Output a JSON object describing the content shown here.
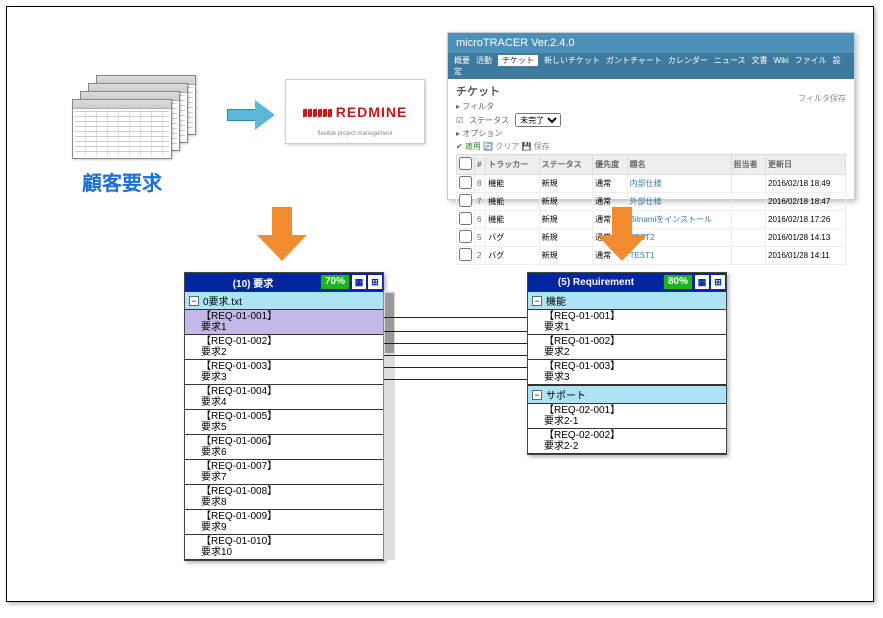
{
  "customer_label": "顧客要求",
  "redmine": {
    "name": "REDMINE",
    "sub": "flexible project management"
  },
  "rm_window": {
    "title": "microTRACER Ver.2.4.0",
    "menu": [
      "概要",
      "活動",
      "チケット",
      "新しいチケット",
      "ガントチャート",
      "カレンダー",
      "ニュース",
      "文書",
      "Wiki",
      "ファイル",
      "設定"
    ],
    "active_tab": "チケット",
    "heading": "チケット",
    "filter_label": "フィルタ",
    "status_label": "ステータス",
    "status_value": "未完了",
    "options_label": "オプション",
    "side_label": "フィルタ保存",
    "actions": {
      "apply": "✔ 適用",
      "clear": "🔄 クリア",
      "save": "💾 保存"
    },
    "cols": [
      "#",
      "トラッカー",
      "ステータス",
      "優先度",
      "題名",
      "担当者",
      "更新日"
    ],
    "rows": [
      {
        "id": "8",
        "tracker": "機能",
        "status": "新規",
        "prio": "通常",
        "title": "内部仕様",
        "assignee": "",
        "date": "2016/02/18 18:49"
      },
      {
        "id": "7",
        "tracker": "機能",
        "status": "新規",
        "prio": "通常",
        "title": "外部仕様",
        "assignee": "",
        "date": "2016/02/18 18:47"
      },
      {
        "id": "6",
        "tracker": "機能",
        "status": "新規",
        "prio": "通常",
        "title": "Bitnamiをインストール",
        "assignee": "",
        "date": "2016/02/18 17:26"
      },
      {
        "id": "5",
        "tracker": "バグ",
        "status": "新規",
        "prio": "通常",
        "title": "TEST2",
        "assignee": "",
        "date": "2016/01/28 14:13"
      },
      {
        "id": "2",
        "tracker": "バグ",
        "status": "新規",
        "prio": "通常",
        "title": "TEST1",
        "assignee": "",
        "date": "2016/01/28 14:11"
      }
    ]
  },
  "panel_left": {
    "title": "(10) 要求",
    "pct": "70%",
    "section": "0要求.txt",
    "items": [
      {
        "id": "【REQ-01-001】",
        "t": "要求1",
        "sel": true
      },
      {
        "id": "【REQ-01-002】",
        "t": "要求2"
      },
      {
        "id": "【REQ-01-003】",
        "t": "要求3"
      },
      {
        "id": "【REQ-01-004】",
        "t": "要求4"
      },
      {
        "id": "【REQ-01-005】",
        "t": "要求5"
      },
      {
        "id": "【REQ-01-006】",
        "t": "要求6"
      },
      {
        "id": "【REQ-01-007】",
        "t": "要求7"
      },
      {
        "id": "【REQ-01-008】",
        "t": "要求8"
      },
      {
        "id": "【REQ-01-009】",
        "t": "要求9"
      },
      {
        "id": "【REQ-01-010】",
        "t": "要求10"
      }
    ]
  },
  "panel_right": {
    "title": "(5) Requirement",
    "pct": "80%",
    "sections": [
      {
        "name": "機能",
        "items": [
          {
            "id": "【REQ-01-001】",
            "t": "要求1"
          },
          {
            "id": "【REQ-01-002】",
            "t": "要求2"
          },
          {
            "id": "【REQ-01-003】",
            "t": "要求3"
          }
        ]
      },
      {
        "name": "サポート",
        "items": [
          {
            "id": "【REQ-02-001】",
            "t": "要求2-1"
          },
          {
            "id": "【REQ-02-002】",
            "t": "要求2-2"
          }
        ]
      }
    ]
  }
}
